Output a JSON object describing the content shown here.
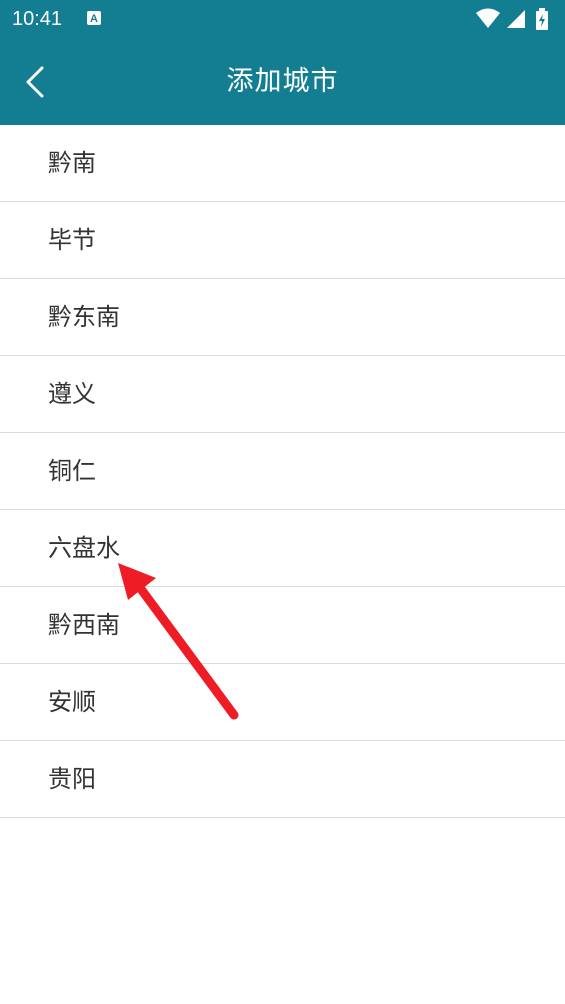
{
  "status_bar": {
    "time": "10:41",
    "notification_icon": "a-icon",
    "icons": [
      "wifi-icon",
      "signal-icon",
      "battery-icon"
    ]
  },
  "app_bar": {
    "title": "添加城市",
    "back_icon": "chevron-left-icon"
  },
  "cities": [
    {
      "label": "黔南"
    },
    {
      "label": "毕节"
    },
    {
      "label": "黔东南"
    },
    {
      "label": "遵义"
    },
    {
      "label": "铜仁"
    },
    {
      "label": "六盘水"
    },
    {
      "label": "黔西南"
    },
    {
      "label": "安顺"
    },
    {
      "label": "贵阳"
    }
  ],
  "colors": {
    "primary": "#137e92",
    "divider": "#dcdcdc",
    "text": "#333333",
    "annotation": "#ee1c25"
  },
  "annotation": {
    "icon": "red-arrow-icon",
    "points_to": "六盘水"
  }
}
